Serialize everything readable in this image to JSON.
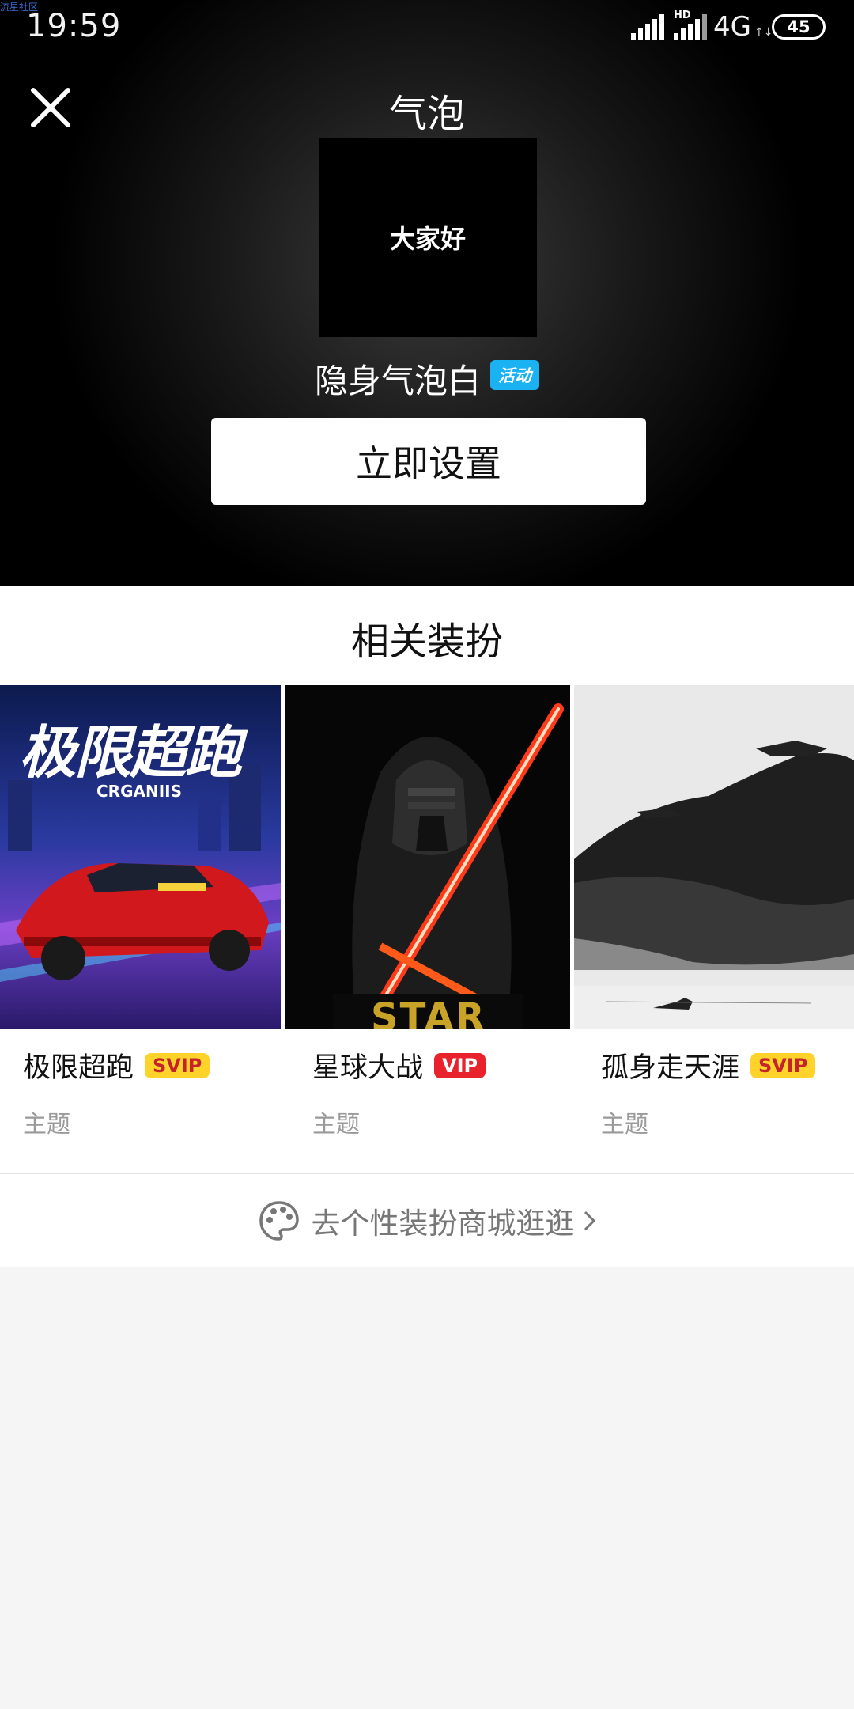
{
  "watermark": "流星社区",
  "status_bar": {
    "time": "19:59",
    "hd_label": "HD",
    "network": "4G",
    "battery": "45"
  },
  "header": {
    "title": "气泡",
    "close_icon": "close-icon"
  },
  "preview": {
    "bubble_text": "大家好"
  },
  "item": {
    "name": "隐身气泡白",
    "badge": "活动"
  },
  "primary_button": {
    "label": "立即设置"
  },
  "related": {
    "title": "相关装扮",
    "cards": [
      {
        "name": "极限超跑",
        "badge": "SVIP",
        "type": "主题",
        "image_text": "极限超跑",
        "image_subtext": "CRGANIIS"
      },
      {
        "name": "星球大战",
        "badge": "VIP",
        "type": "主题",
        "image_text": "STAR"
      },
      {
        "name": "孤身走天涯",
        "badge": "SVIP",
        "type": "主题"
      }
    ]
  },
  "mall_link": {
    "label": "去个性装扮商城逛逛",
    "icon": "palette-icon",
    "arrow": "chevron-right-icon"
  },
  "colors": {
    "activity_badge": "#1ab2f2",
    "svip_badge": "#ffd32a",
    "vip_badge": "#e8232b"
  }
}
